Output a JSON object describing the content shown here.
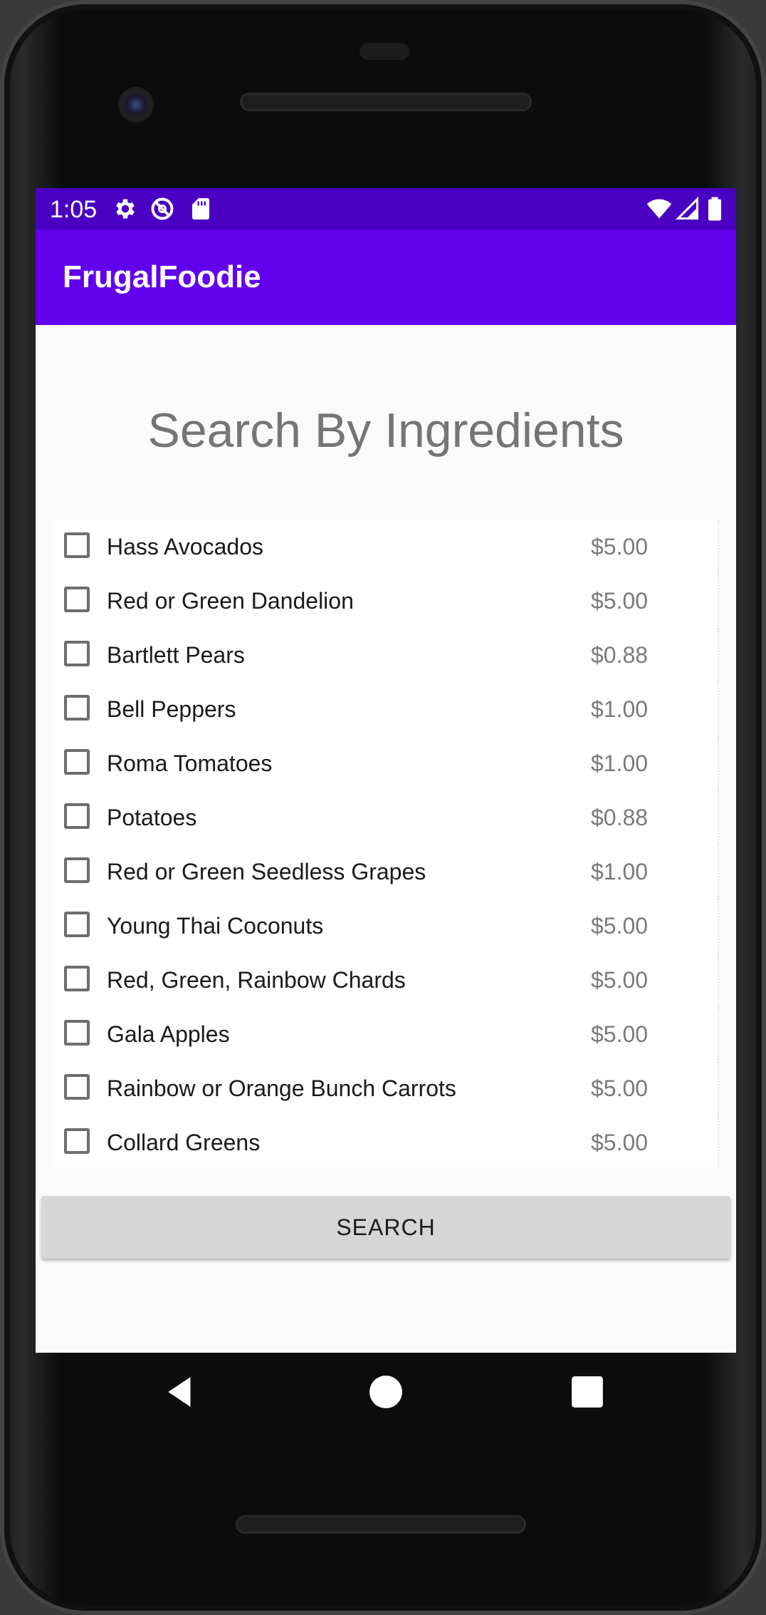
{
  "status_bar": {
    "time": "1:05",
    "left_icons": [
      "gear-icon",
      "do-not-disturb-icon",
      "sd-card-icon"
    ],
    "right_icons": [
      "wifi-icon",
      "signal-icon",
      "battery-icon"
    ]
  },
  "app_bar": {
    "title": "FrugalFoodie"
  },
  "page": {
    "heading": "Search By Ingredients"
  },
  "ingredients": [
    {
      "name": "Hass Avocados",
      "price": "$5.00",
      "checked": false
    },
    {
      "name": "Red or Green Dandelion",
      "price": "$5.00",
      "checked": false
    },
    {
      "name": "Bartlett Pears",
      "price": "$0.88",
      "checked": false
    },
    {
      "name": "Bell Peppers",
      "price": "$1.00",
      "checked": false
    },
    {
      "name": "Roma Tomatoes",
      "price": "$1.00",
      "checked": false
    },
    {
      "name": "Potatoes",
      "price": "$0.88",
      "checked": false
    },
    {
      "name": "Red or Green Seedless Grapes",
      "price": "$1.00",
      "checked": false
    },
    {
      "name": "Young Thai Coconuts",
      "price": "$5.00",
      "checked": false
    },
    {
      "name": "Red, Green, Rainbow Chards",
      "price": "$5.00",
      "checked": false
    },
    {
      "name": "Gala Apples",
      "price": "$5.00",
      "checked": false
    },
    {
      "name": "Rainbow or Orange Bunch Carrots",
      "price": "$5.00",
      "checked": false
    },
    {
      "name": "Collard Greens",
      "price": "$5.00",
      "checked": false
    }
  ],
  "search_button": {
    "label": "SEARCH"
  },
  "nav_bar": {
    "icons": [
      "back-icon",
      "home-icon",
      "recents-icon"
    ]
  },
  "colors": {
    "status_bar": "#4a00c2",
    "app_bar": "#6200ee",
    "background": "#fafafa",
    "button": "#d6d6d6"
  }
}
